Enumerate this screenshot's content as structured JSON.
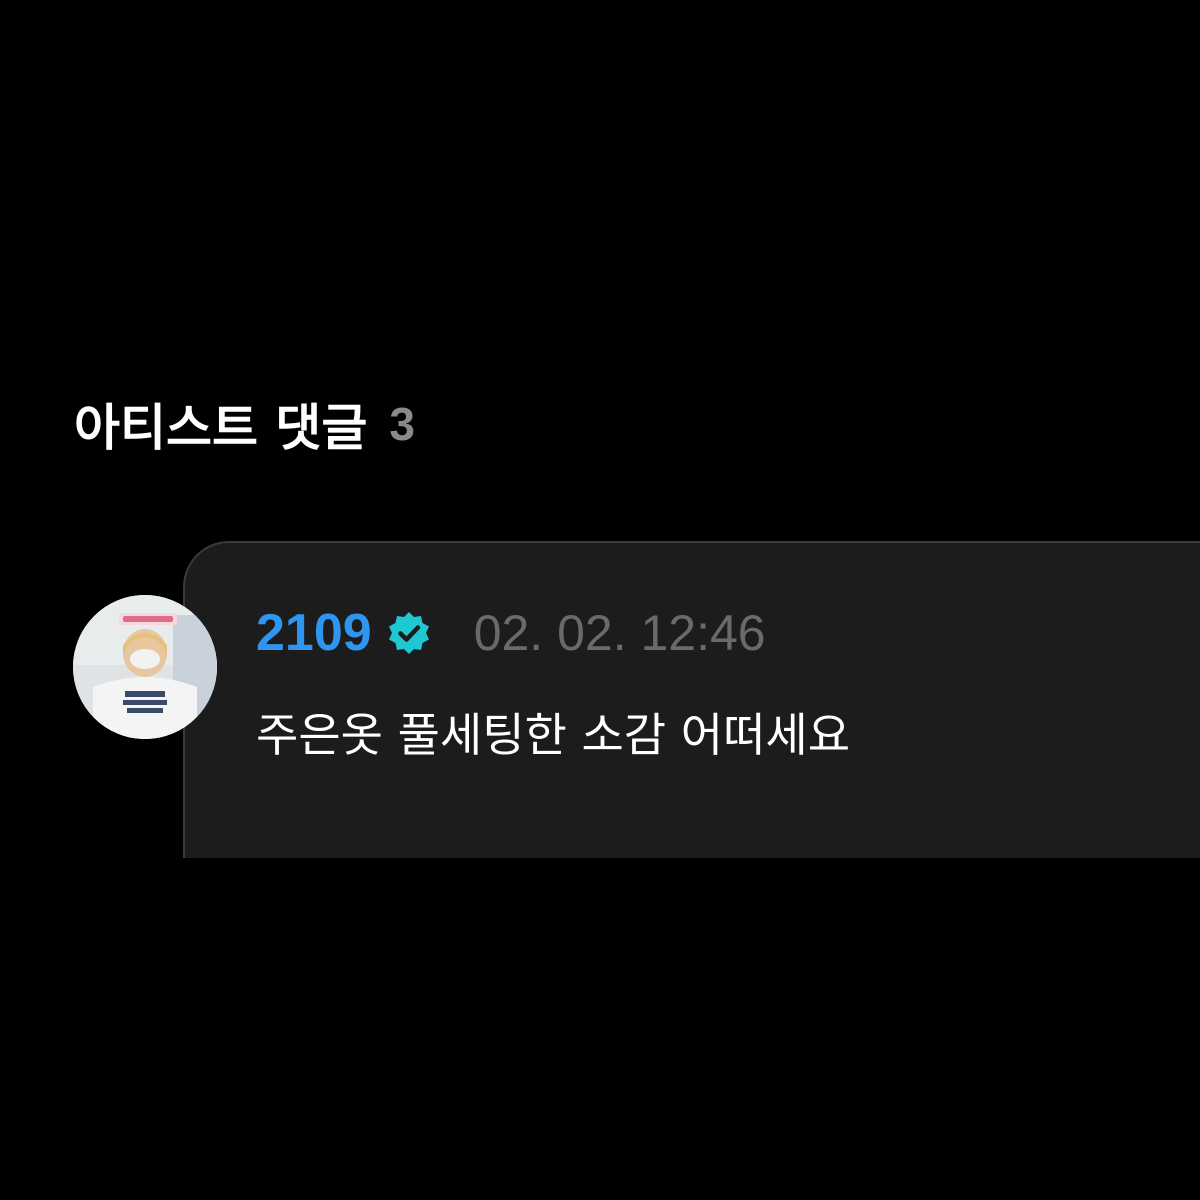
{
  "section": {
    "title": "아티스트 댓글",
    "count": "3"
  },
  "comment": {
    "author": "2109",
    "timestamp": "02. 02. 12:46",
    "text": "주은옷 풀세팅한 소감 어떠세요",
    "avatar_icon": "user-avatar-photo",
    "verified_icon": "verified-badge-icon"
  },
  "colors": {
    "background": "#000000",
    "card": "#1c1c1c",
    "author": "#2e95f0",
    "verified": "#1ec8d2",
    "timestamp": "#6a6a6a",
    "count": "#8a8a8a"
  }
}
